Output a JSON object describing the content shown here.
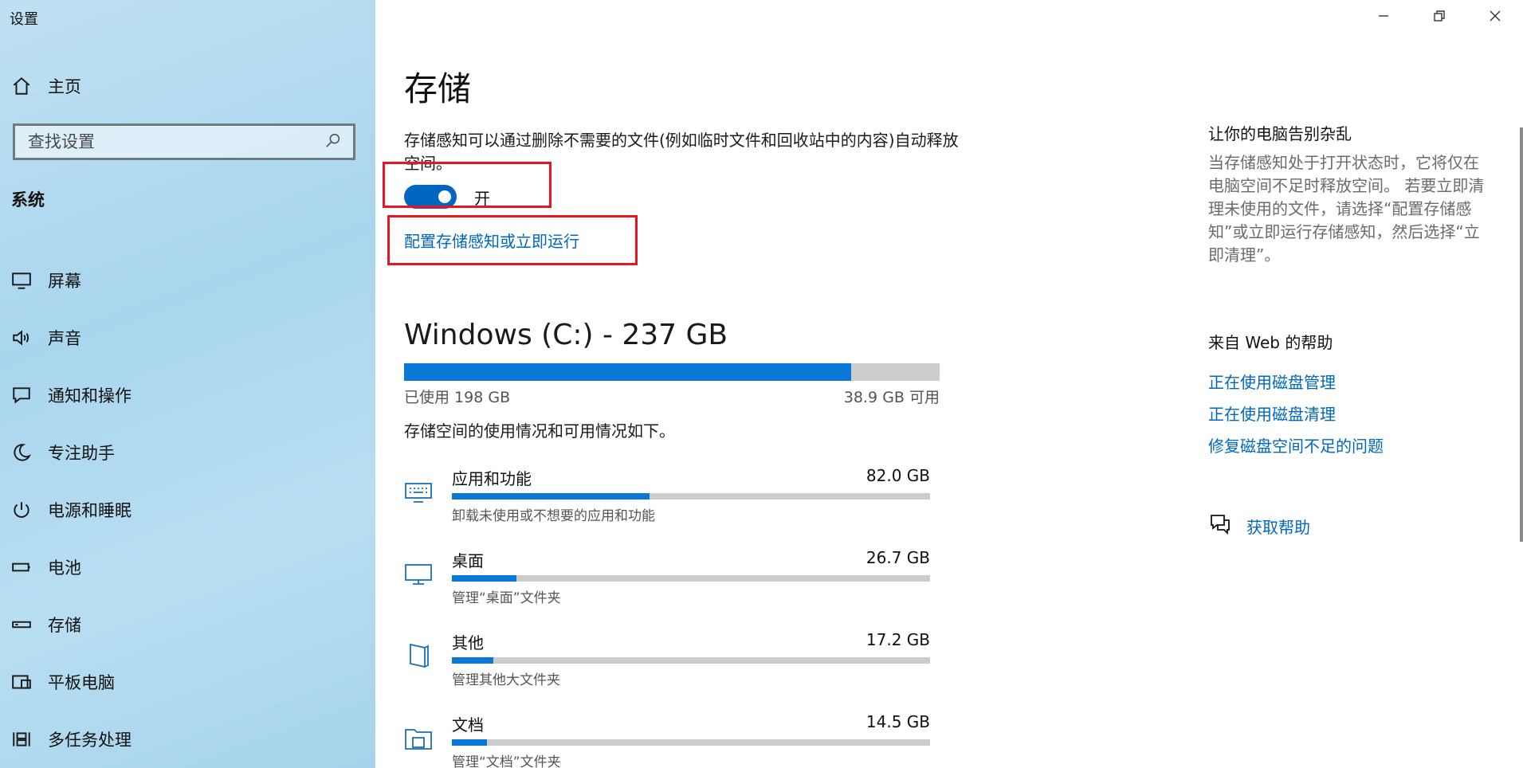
{
  "window": {
    "title": "设置",
    "controls": {
      "minimize": "minimize-icon",
      "maximize": "restore-icon",
      "close": "close-icon"
    }
  },
  "sidebar": {
    "home_label": "主页",
    "search_placeholder": "查找设置",
    "section_title": "系统",
    "items": [
      {
        "label": "屏幕",
        "icon": "display-icon"
      },
      {
        "label": "声音",
        "icon": "speaker-icon"
      },
      {
        "label": "通知和操作",
        "icon": "notification-icon"
      },
      {
        "label": "专注助手",
        "icon": "moon-icon"
      },
      {
        "label": "电源和睡眠",
        "icon": "power-icon"
      },
      {
        "label": "电池",
        "icon": "battery-icon"
      },
      {
        "label": "存储",
        "icon": "storage-icon"
      },
      {
        "label": "平板电脑",
        "icon": "tablet-icon"
      },
      {
        "label": "多任务处理",
        "icon": "multitask-icon"
      }
    ]
  },
  "main": {
    "title": "存储",
    "storage_sense_desc": "存储感知可以通过删除不需要的文件(例如临时文件和回收站中的内容)自动释放空间。",
    "toggle": {
      "state_label": "开",
      "on": true
    },
    "config_link": "配置存储感知或立即运行",
    "drive": {
      "title": "Windows (C:) - 237 GB",
      "used_label": "已使用 198 GB",
      "free_label": "38.9 GB 可用",
      "used_fraction": 0.835
    },
    "usage_desc": "存储空间的使用情况和可用情况如下。",
    "categories": [
      {
        "name": "应用和功能",
        "size": "82.0 GB",
        "sub": "卸载未使用或不想要的应用和功能",
        "fraction": 0.414,
        "icon": "keyboard-icon"
      },
      {
        "name": "桌面",
        "size": "26.7 GB",
        "sub": "管理“桌面”文件夹",
        "fraction": 0.135,
        "icon": "monitor-icon"
      },
      {
        "name": "其他",
        "size": "17.2 GB",
        "sub": "管理其他大文件夹",
        "fraction": 0.087,
        "icon": "document-icon"
      },
      {
        "name": "文档",
        "size": "14.5 GB",
        "sub": "管理“文档”文件夹",
        "fraction": 0.073,
        "icon": "folder-icon"
      }
    ]
  },
  "right_panel": {
    "tips_title": "让你的电脑告别杂乱",
    "tips_body": "当存储感知处于打开状态时，它将仅在电脑空间不足时释放空间。 若要立即清理未使用的文件，请选择“配置存储感知”或立即运行存储感知，然后选择“立即清理”。",
    "web_help_title": "来自 Web 的帮助",
    "links": [
      "正在使用磁盘管理",
      "正在使用磁盘清理",
      "修复磁盘空间不足的问题"
    ],
    "get_help": "获取帮助"
  },
  "colors": {
    "accent": "#0067c0",
    "bar_fill": "#0a78d7",
    "highlight": "#e8141f"
  }
}
